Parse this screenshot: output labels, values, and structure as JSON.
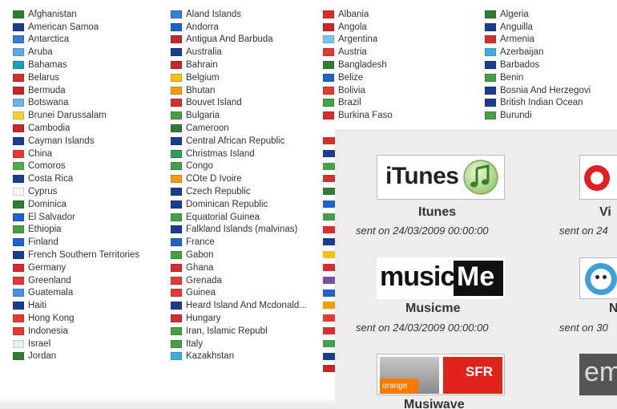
{
  "countries": {
    "col1": [
      {
        "label": "Afghanistan",
        "flag": "#2e7d32"
      },
      {
        "label": "American Samoa",
        "flag": "#1a3d8f"
      },
      {
        "label": "Antarctica",
        "flag": "#3a7bd5"
      },
      {
        "label": "Aruba",
        "flag": "#5fa8e0"
      },
      {
        "label": "Bahamas",
        "flag": "#1aa3b8"
      },
      {
        "label": "Belarus",
        "flag": "#d32f2f"
      },
      {
        "label": "Bermuda",
        "flag": "#c62828"
      },
      {
        "label": "Botswana",
        "flag": "#6cb4e6"
      },
      {
        "label": "Brunei Darussalam",
        "flag": "#f4d03f"
      },
      {
        "label": "Cambodia",
        "flag": "#c62828"
      },
      {
        "label": "Cayman Islands",
        "flag": "#1a3d8f"
      },
      {
        "label": "China",
        "flag": "#e53935"
      },
      {
        "label": "Comoros",
        "flag": "#4caf50"
      },
      {
        "label": "Costa Rica",
        "flag": "#1a3d8f"
      },
      {
        "label": "Cyprus",
        "flag": "#f5f5f5"
      },
      {
        "label": "Dominica",
        "flag": "#2e7d32"
      },
      {
        "label": "El Salvador",
        "flag": "#1e64c8"
      },
      {
        "label": "Ethiopia",
        "flag": "#43a047"
      },
      {
        "label": "Finland",
        "flag": "#1e64c8"
      },
      {
        "label": "French Southern Territories",
        "flag": "#1a3d8f"
      },
      {
        "label": "Germany",
        "flag": "#d32f2f"
      },
      {
        "label": "Greenland",
        "flag": "#e53935"
      },
      {
        "label": "Guatemala",
        "flag": "#4a90e2"
      },
      {
        "label": "Haiti",
        "flag": "#1a3d8f"
      },
      {
        "label": "Hong Kong",
        "flag": "#e53935"
      },
      {
        "label": "Indonesia",
        "flag": "#e53935"
      },
      {
        "label": "Israel",
        "flag": "#e8eef8"
      },
      {
        "label": "Jordan",
        "flag": "#2e7d32"
      }
    ],
    "col2": [
      {
        "label": "Åland Islands",
        "flag": "#3a7bd5"
      },
      {
        "label": "Andorra",
        "flag": "#1e64c8"
      },
      {
        "label": "Antigua And Barbuda",
        "flag": "#c62828"
      },
      {
        "label": "Australia",
        "flag": "#1a3d8f"
      },
      {
        "label": "Bahrain",
        "flag": "#c62828"
      },
      {
        "label": "Belgium",
        "flag": "#f4c20d"
      },
      {
        "label": "Bhutan",
        "flag": "#f39c12"
      },
      {
        "label": "Bouvet Island",
        "flag": "#d32f2f"
      },
      {
        "label": "Bulgaria",
        "flag": "#43a047"
      },
      {
        "label": "Cameroon",
        "flag": "#2e7d32"
      },
      {
        "label": "Central African Republic",
        "flag": "#1a3d8f"
      },
      {
        "label": "Christmas Island",
        "flag": "#2e9e5b"
      },
      {
        "label": "Congo",
        "flag": "#43a047"
      },
      {
        "label": "CÔte D Ivoire",
        "flag": "#f39c12"
      },
      {
        "label": "Czech Republic",
        "flag": "#1a3d8f"
      },
      {
        "label": "Dominican Republic",
        "flag": "#1a3d8f"
      },
      {
        "label": "Equatorial Guinea",
        "flag": "#43a047"
      },
      {
        "label": "Falkland Islands (malvinas)",
        "flag": "#1a3d8f"
      },
      {
        "label": "France",
        "flag": "#1e64c8"
      },
      {
        "label": "Gabon",
        "flag": "#43a047"
      },
      {
        "label": "Ghana",
        "flag": "#d32f2f"
      },
      {
        "label": "Grenada",
        "flag": "#e53935"
      },
      {
        "label": "Guinea",
        "flag": "#e53935"
      },
      {
        "label": "Heard Island And Mcdonald...",
        "flag": "#1a3d8f"
      },
      {
        "label": "Hungary",
        "flag": "#d32f2f"
      },
      {
        "label": "Iran, Islamic Republ",
        "flag": "#43a047"
      },
      {
        "label": "Italy",
        "flag": "#43a047"
      },
      {
        "label": "Kazakhstan",
        "flag": "#3ab0e0"
      }
    ],
    "col3": [
      {
        "label": "Albania",
        "flag": "#d32f2f"
      },
      {
        "label": "Angola",
        "flag": "#c62828"
      },
      {
        "label": "Argentina",
        "flag": "#7ec3ee"
      },
      {
        "label": "Austria",
        "flag": "#e53935"
      },
      {
        "label": "Bangladesh",
        "flag": "#2e7d32"
      },
      {
        "label": "Belize",
        "flag": "#1e64c8"
      },
      {
        "label": "Bolivia",
        "flag": "#e53935"
      },
      {
        "label": "Brazil",
        "flag": "#43a047"
      },
      {
        "label": "Burkina Faso",
        "flag": "#d32f2f"
      }
    ],
    "col4": [
      {
        "label": "Algeria",
        "flag": "#2e7d32"
      },
      {
        "label": "Anguilla",
        "flag": "#1a3d8f"
      },
      {
        "label": "Armenia",
        "flag": "#d32f2f"
      },
      {
        "label": "Azerbaijan",
        "flag": "#3ab0e0"
      },
      {
        "label": "Barbados",
        "flag": "#1a3d8f"
      },
      {
        "label": "Benin",
        "flag": "#43a047"
      },
      {
        "label": "Bosnia And Herzegovi",
        "flag": "#1a3d8f"
      },
      {
        "label": "British Indian Ocean",
        "flag": "#1a3d8f"
      },
      {
        "label": "Burundi",
        "flag": "#43a047"
      }
    ],
    "col3_clipped_flags": [
      "#d32f2f",
      "#1a3d8f",
      "#43a047",
      "#d32f2f",
      "#2e7d32",
      "#1e64c8",
      "#43a047",
      "#d32f2f",
      "#1a3d8f",
      "#f4c20d",
      "#d32f2f",
      "#7b4fa0",
      "#1e64c8",
      "#f39c12",
      "#e53935",
      "#d32f2f",
      "#43a047",
      "#1a3d8f",
      "#c62828"
    ]
  },
  "providers": [
    {
      "name": "Itunes",
      "sent": "sent on 24/03/2009 00:00:00",
      "logo": "itunes-logo"
    },
    {
      "name": "Vi",
      "sent": "sent on 24",
      "logo": "virgin-logo"
    },
    {
      "name": "Musicme",
      "sent": "sent on 24/03/2009 00:00:00",
      "logo": "musicme-logo"
    },
    {
      "name": "N",
      "sent": "sent on 30",
      "logo": "napster-logo"
    },
    {
      "name": "Musiwave",
      "sent": "",
      "logo": "orange-sfr-logo"
    },
    {
      "name": "",
      "sent": "",
      "logo": "emusic-logo"
    }
  ],
  "logos": {
    "itunes_text": "iTunes",
    "musicme_text_1": "music",
    "musicme_text_2": "Me",
    "orange_text": "orange",
    "sfr_text": "SFR",
    "emusic_text": "em"
  }
}
